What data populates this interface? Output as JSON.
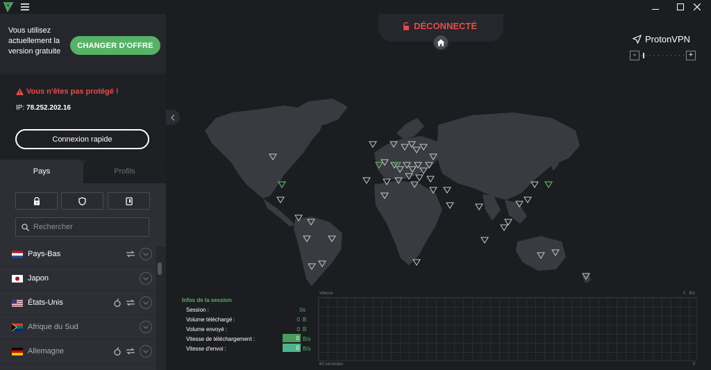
{
  "titlebar": {
    "menu_icon": "hamburger-icon",
    "logo_icon": "proton-triangle-icon"
  },
  "upsell": {
    "text": "Vous utilisez actuellement la version gratuite",
    "button_label": "CHANGER D'OFFRE"
  },
  "status": {
    "warning": "Vous n'êtes pas protégé !",
    "ip_label": "IP:",
    "ip_value": "78.252.202.16",
    "quick_connect": "Connexion rapide"
  },
  "tabs": {
    "countries": "Pays",
    "profiles": "Profils"
  },
  "filters": [
    {
      "icon": "lock-icon"
    },
    {
      "icon": "shield-icon"
    },
    {
      "icon": "tor-card-icon"
    }
  ],
  "search": {
    "placeholder": "Rechercher"
  },
  "countries": [
    {
      "name": "Pays-Bas",
      "features": [
        "p2p"
      ],
      "dim": false
    },
    {
      "name": "Japon",
      "features": [],
      "dim": false
    },
    {
      "name": "États-Unis",
      "features": [
        "tor",
        "p2p"
      ],
      "dim": false
    },
    {
      "name": "Afrique du Sud",
      "features": [],
      "dim": true
    },
    {
      "name": "Allemagne",
      "features": [
        "tor",
        "p2p"
      ],
      "dim": true
    }
  ],
  "connection": {
    "status": "DÉCONNECTÉ",
    "color": "#e84a4a"
  },
  "brand": {
    "name": "ProtonVPN"
  },
  "zoom": {
    "minus": "-",
    "plus": "+"
  },
  "session": {
    "title": "Infos de la session",
    "rows": [
      {
        "label": "Session :",
        "value": "0s",
        "unit": ""
      },
      {
        "label": "Volume téléchargé :",
        "value": "0",
        "unit": "B"
      },
      {
        "label": "Volume envoyé :",
        "value": "0",
        "unit": "B"
      },
      {
        "label": "Vitesse de téléchargement :",
        "value": "0",
        "unit": "B/s"
      },
      {
        "label": "Vitesse d'envoi :",
        "value": "0",
        "unit": "B/s"
      }
    ]
  },
  "graph": {
    "title": "Vitesse",
    "top_right": "0   B/s",
    "bottom_left": "60 secondes",
    "bottom_right": "0"
  },
  "colors": {
    "accent": "#56b366",
    "danger": "#e84a4a",
    "bg": "#1c1d21",
    "sidebar": "#25272c"
  }
}
